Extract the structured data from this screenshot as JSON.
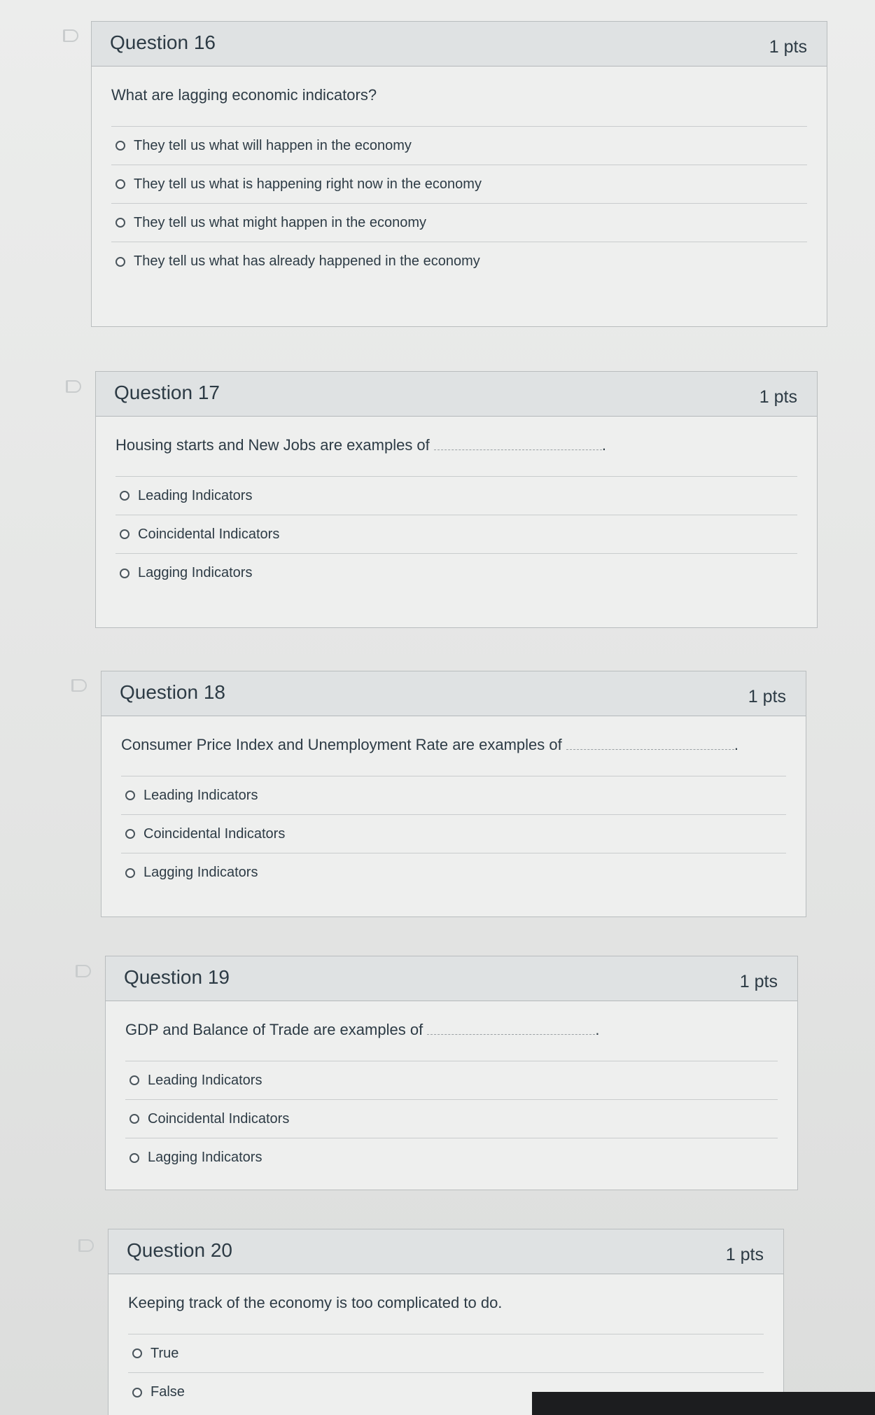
{
  "questions": [
    {
      "title": "Question 16",
      "points": "1 pts",
      "text": "What are lagging economic indicators?",
      "has_blank": false,
      "answers": [
        "They tell us what will happen in the economy",
        "They tell us what is happening right now in the economy",
        "They tell us what might happen in the economy",
        "They tell us what has already happened in the economy"
      ]
    },
    {
      "title": "Question 17",
      "points": "1 pts",
      "text": "Housing starts and New Jobs are examples of",
      "has_blank": true,
      "answers": [
        "Leading Indicators",
        "Coincidental Indicators",
        "Lagging Indicators"
      ]
    },
    {
      "title": "Question 18",
      "points": "1 pts",
      "text": "Consumer Price Index and Unemployment Rate are examples of",
      "has_blank": true,
      "answers": [
        "Leading Indicators",
        "Coincidental Indicators",
        "Lagging Indicators"
      ]
    },
    {
      "title": "Question 19",
      "points": "1 pts",
      "text": "GDP and Balance of Trade are examples of",
      "has_blank": true,
      "answers": [
        "Leading Indicators",
        "Coincidental Indicators",
        "Lagging Indicators"
      ]
    },
    {
      "title": "Question 20",
      "points": "1 pts",
      "text": "Keeping track of the economy is too complicated to do.",
      "has_blank": false,
      "answers": [
        "True",
        "False"
      ]
    }
  ],
  "icons": {
    "flag": "bookmark-flag-icon",
    "radio": "radio-unselected"
  },
  "colors": {
    "background": "#e6e7e6",
    "header": "#dfe2e3",
    "border": "#b9bdbe",
    "text": "#2d3b45"
  }
}
